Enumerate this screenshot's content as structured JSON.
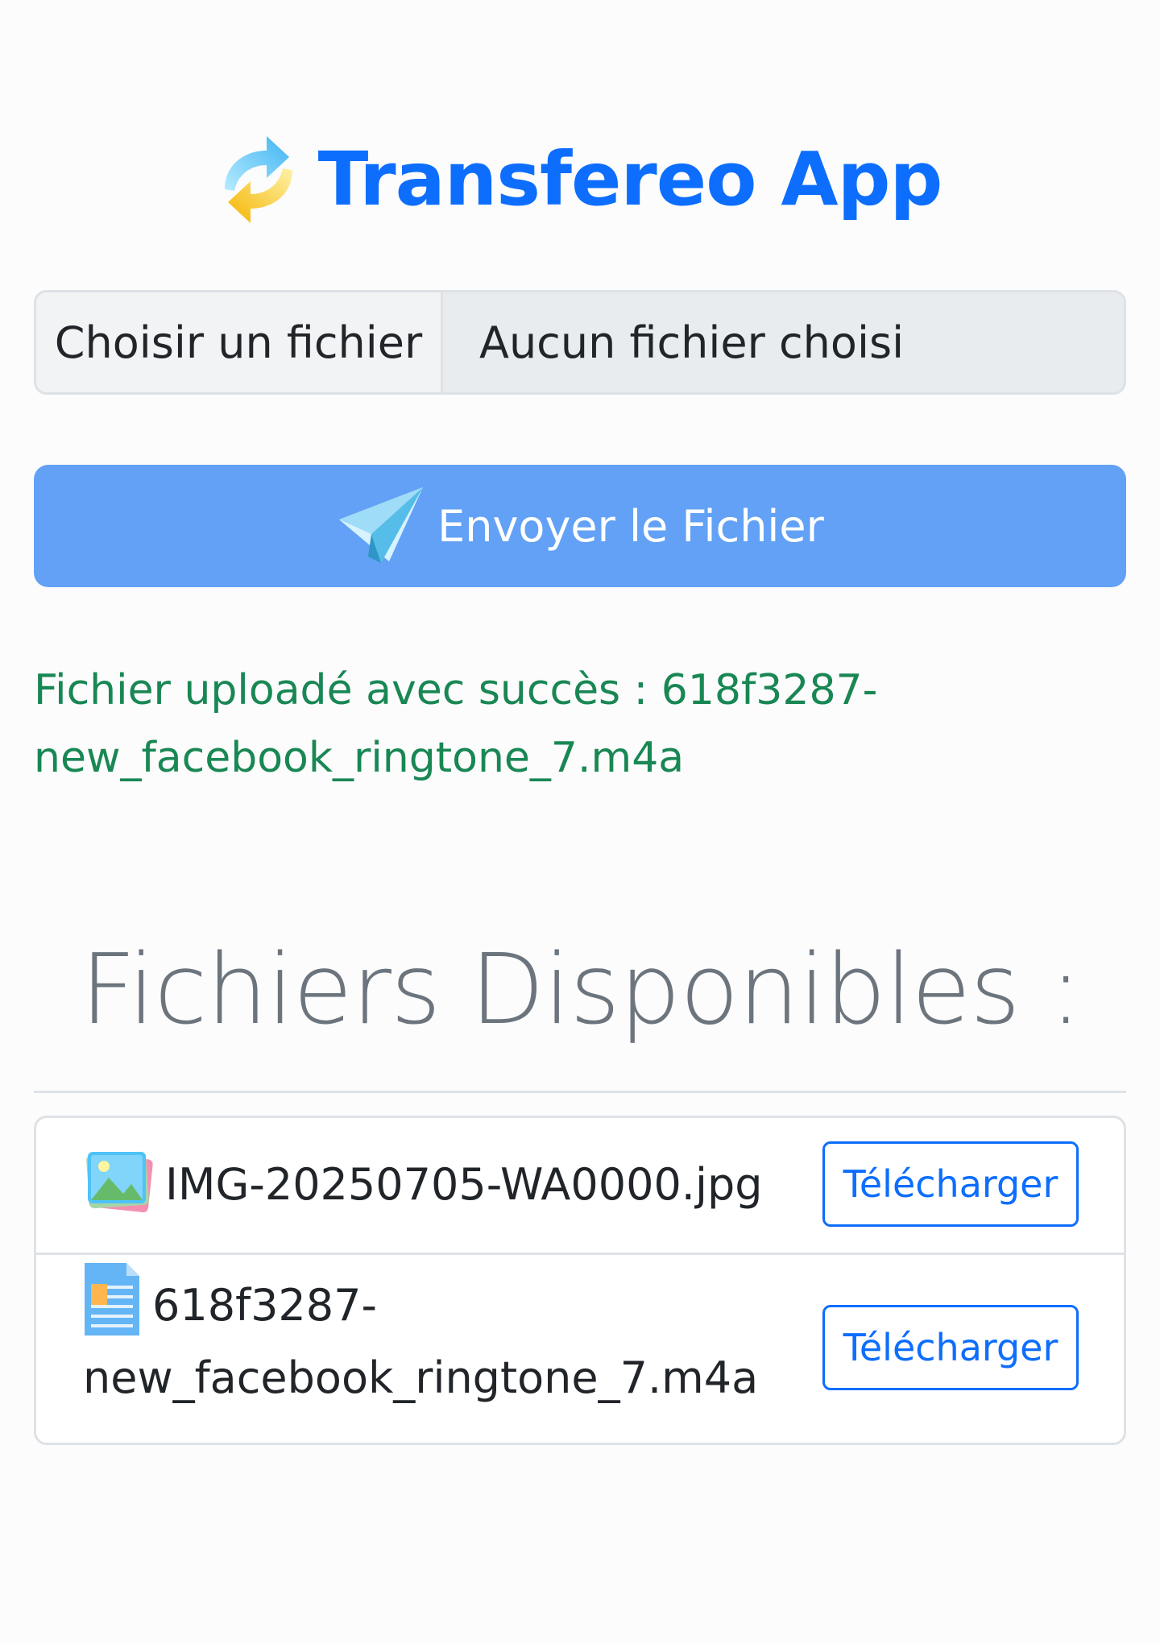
{
  "app": {
    "title": "Transfereo App",
    "logo_icon": "refresh-arrows-icon"
  },
  "upload": {
    "choose_label": "Choisir un fichier",
    "status_text": "Aucun fichier choisi",
    "send_label": "Envoyer le Fichier",
    "send_icon": "paper-plane-icon"
  },
  "message": {
    "success_line1": "Fichier uploadé avec succès : 618f3287-",
    "success_line2": "new_facebook_ringtone_7.m4a"
  },
  "files_section": {
    "title": "Fichiers Disponibles :",
    "items": [
      {
        "icon": "image-file-icon",
        "name": "IMG-20250705-WA0000.jpg",
        "action": "Télécharger"
      },
      {
        "icon": "document-file-icon",
        "name_line1": "618f3287-",
        "name_line2": "new_facebook_ringtone_7.m4a",
        "action": "Télécharger"
      }
    ]
  },
  "colors": {
    "primary": "#0d6efd",
    "send_button": "#62a1f5",
    "success": "#198754",
    "muted_heading": "#6c757d"
  }
}
